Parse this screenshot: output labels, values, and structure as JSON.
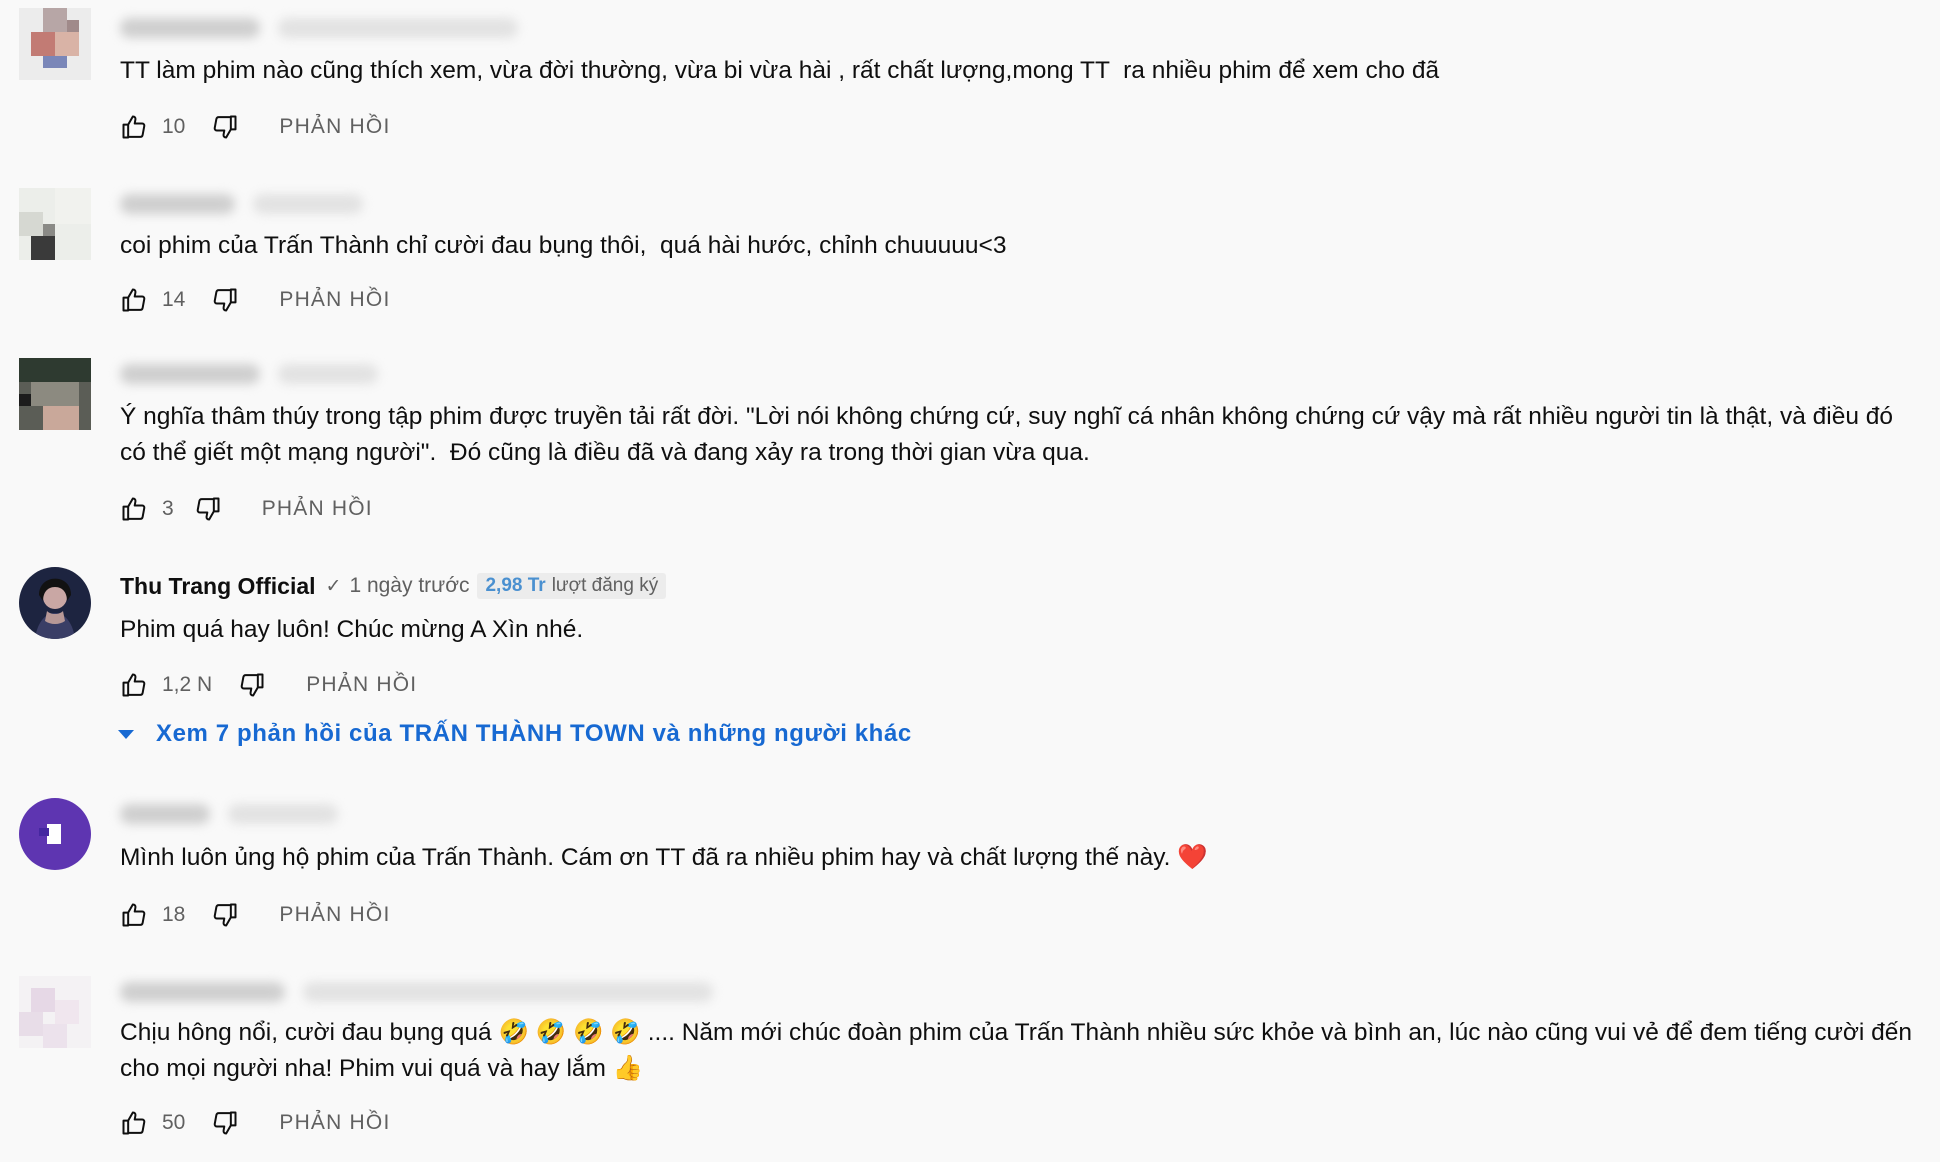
{
  "comments": [
    {
      "text": "TT làm phim nào cũng thích xem, vừa đời thường, vừa bi vừa hài , rất chất lượng,mong TT  ra nhiều phim để xem cho đã",
      "likes": "10",
      "reply_label": "PHẢN HỒI"
    },
    {
      "text": "coi phim của Trấn Thành chỉ cười đau bụng thôi,  quá hài hước, chỉnh chuuuuu<3",
      "likes": "14",
      "reply_label": "PHẢN HỒI"
    },
    {
      "text": "Ý nghĩa thâm thúy trong tập phim được truyền tải rất đời. \"Lời nói không chứng cứ, suy nghĩ cá nhân không chứng cứ vậy mà rất nhiều người tin là thật, và điều đó có thể giết một mạng người\".  Đó cũng là điều đã và đang xảy ra trong thời gian vừa qua.",
      "likes": "3",
      "reply_label": "PHẢN HỒI"
    },
    {
      "author": "Thu Trang Official",
      "verified_icon": "✓",
      "time": "1 ngày trước",
      "subscribers": "2,98 Tr",
      "subscribers_label": "lượt đăng ký",
      "text": "Phim quá hay luôn! Chúc mừng A Xìn nhé.",
      "likes": "1,2 N",
      "reply_label": "PHẢN HỒI",
      "view_replies": "Xem 7 phản hồi của TRẤN THÀNH TOWN và những người khác"
    },
    {
      "text": "Mình luôn ủng hộ phim của Trấn Thành. Cám ơn TT đã ra nhiều phim hay và chất lượng thế này. ❤️",
      "likes": "18",
      "reply_label": "PHẢN HỒI"
    },
    {
      "text": "Chịu hông nổi, cười đau bụng quá 🤣 🤣 🤣 🤣 .... Năm mới chúc đoàn phim của Trấn Thành nhiều sức khỏe và bình an, lúc nào cũng vui vẻ để đem tiếng cười đến cho mọi người nha! Phim vui quá và hay lắm 👍",
      "likes": "50",
      "reply_label": "PHẢN HỒI"
    }
  ],
  "colors": {
    "background": "#f9f9f9",
    "link_blue": "#1769d2",
    "secondary_text": "#606060"
  }
}
